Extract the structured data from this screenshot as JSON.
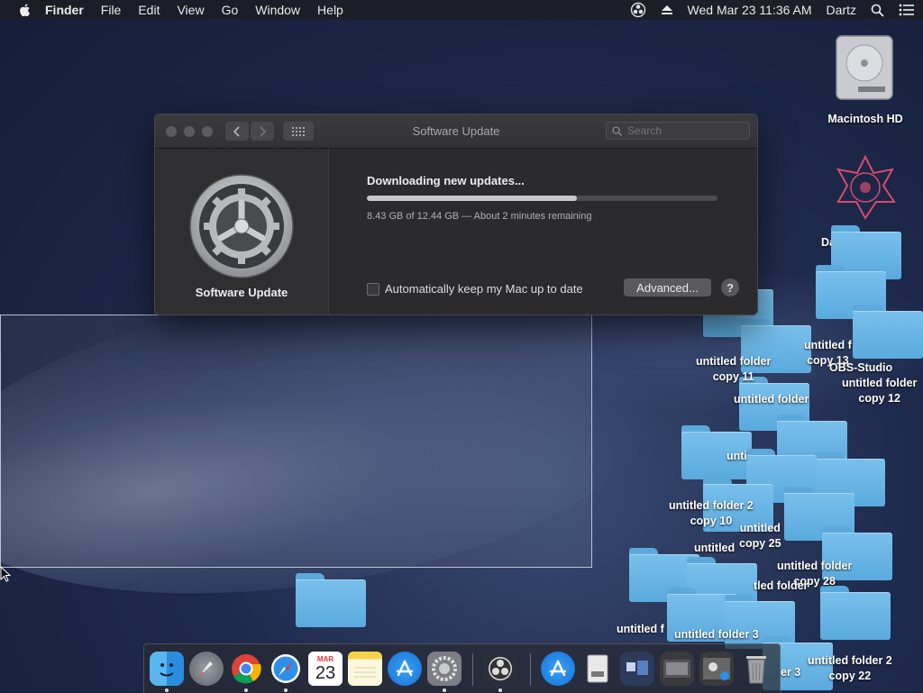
{
  "menubar": {
    "app": "Finder",
    "items": [
      "File",
      "Edit",
      "View",
      "Go",
      "Window",
      "Help"
    ],
    "clock": "Wed Mar 23  11:36 AM",
    "user": "Dartz"
  },
  "window": {
    "title": "Software Update",
    "search_placeholder": "Search",
    "pane_label": "Software Update",
    "download_title": "Downloading new updates...",
    "progress_fraction": 0.6,
    "download_status": "8.43 GB of 12.44 GB — About 2 minutes remaining",
    "auto_update_label": "Automatically keep my Mac up to date",
    "auto_update_checked": false,
    "advanced_label": "Advanced...",
    "help_label": "?"
  },
  "desktop": {
    "icons": {
      "hd": "Macintosh HD",
      "dartz": "Da",
      "obs": "OBS-Studio",
      "f1a": "untitled folder",
      "f1b": "copy 11",
      "f2a": "untitled f",
      "f2b": "copy 13",
      "f3a": "untitled folder",
      "f3b": "copy 12",
      "f4": "untitled folder",
      "f5": "unti",
      "f6a": "untitled folder 2",
      "f6b": "copy 10",
      "f7a": "untitled",
      "f7b": "copy 25",
      "f8": "untitled",
      "f9a": "untitled folder",
      "f9b": "copy 28",
      "f10": "tled folder",
      "f11a": "untitled f",
      "f12": "untitled folder 3",
      "f13a": "untitled folder 2",
      "f13b": "copy 22",
      "f14": "er 3"
    }
  },
  "dock": {
    "apps": [
      "Finder",
      "Launchpad",
      "Google Chrome",
      "Safari",
      "Calendar",
      "Notes",
      "App Store",
      "System Preferences",
      "OBS",
      "App Store Downloads",
      "Disk Image",
      "Recent Items",
      "Photo Booth",
      "Preview",
      "Trash"
    ],
    "calendar_month": "MAR",
    "calendar_day": "23"
  },
  "colors": {
    "folder": "#69b6e6",
    "window_bg": "#2b2b2d"
  }
}
